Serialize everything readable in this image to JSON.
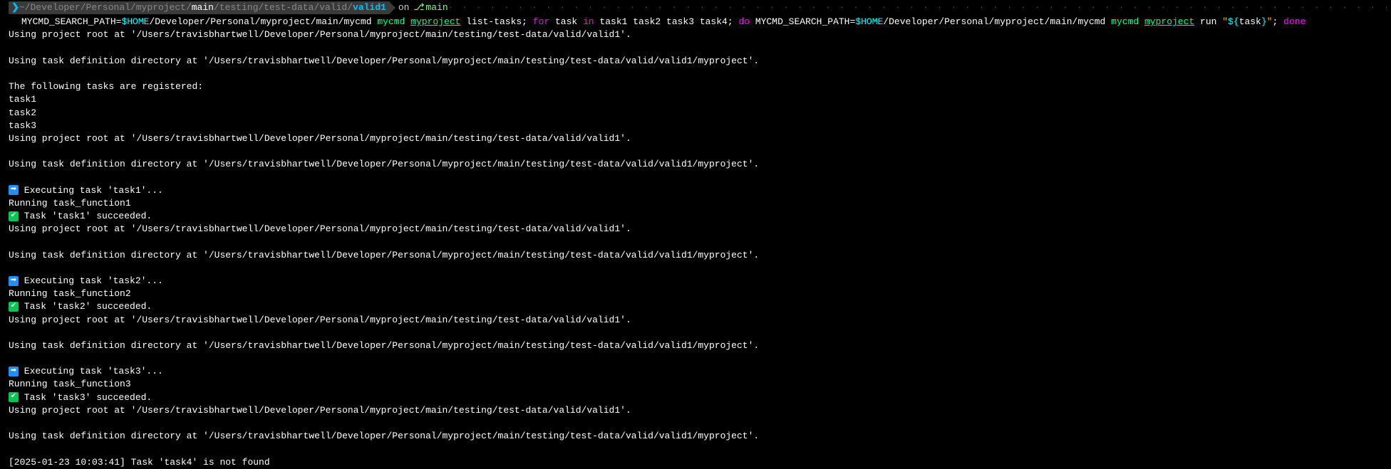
{
  "prompt": {
    "path_prefix": "~/Developer/Personal/myproject/",
    "path_mid1": "main",
    "path_mid2": "/testing/test-data/valid/",
    "path_last": "valid1",
    "on": "on",
    "branch": "main"
  },
  "command": {
    "s1": "MYCMD_SEARCH_PATH=",
    "s2": "$HOME",
    "s3": "/Developer/Personal/myproject/main/mycmd ",
    "s4": "mycmd",
    "s5": " ",
    "s6": "myproject",
    "s7": " list-tasks; ",
    "s8": "for",
    "s9": " task ",
    "s10": "in",
    "s11": " task1 task2 task3 task4; ",
    "s12": "do",
    "s13": " MYCMD_SEARCH_PATH=",
    "s14": "$HOME",
    "s15": "/Developer/Personal/myproject/main/mycmd ",
    "s16": "mycmd",
    "s17": " ",
    "s18": "myproject",
    "s19": " run ",
    "s20": "\"",
    "s21": "${",
    "s22": "task",
    "s23": "}",
    "s24": "\"",
    "s25": "; ",
    "s26": "done"
  },
  "out": {
    "l1": "Using project root at '/Users/travisbhartwell/Developer/Personal/myproject/main/testing/test-data/valid/valid1'.",
    "l2": "Using task definition directory at '/Users/travisbhartwell/Developer/Personal/myproject/main/testing/test-data/valid/valid1/myproject'.",
    "l3": "The following tasks are registered:",
    "l4": "task1",
    "l5": "task2",
    "l6": "task3",
    "l7": "Using project root at '/Users/travisbhartwell/Developer/Personal/myproject/main/testing/test-data/valid/valid1'.",
    "l8": "Using task definition directory at '/Users/travisbhartwell/Developer/Personal/myproject/main/testing/test-data/valid/valid1/myproject'.",
    "l9a": " Executing task 'task1'...",
    "l10": "Running task_function1",
    "l11a": " Task 'task1' succeeded.",
    "l12": "Using project root at '/Users/travisbhartwell/Developer/Personal/myproject/main/testing/test-data/valid/valid1'.",
    "l13": "Using task definition directory at '/Users/travisbhartwell/Developer/Personal/myproject/main/testing/test-data/valid/valid1/myproject'.",
    "l14a": " Executing task 'task2'...",
    "l15": "Running task_function2",
    "l16a": " Task 'task2' succeeded.",
    "l17": "Using project root at '/Users/travisbhartwell/Developer/Personal/myproject/main/testing/test-data/valid/valid1'.",
    "l18": "Using task definition directory at '/Users/travisbhartwell/Developer/Personal/myproject/main/testing/test-data/valid/valid1/myproject'.",
    "l19a": " Executing task 'task3'...",
    "l20": "Running task_function3",
    "l21a": " Task 'task3' succeeded.",
    "l22": "Using project root at '/Users/travisbhartwell/Developer/Personal/myproject/main/testing/test-data/valid/valid1'.",
    "l23": "Using task definition directory at '/Users/travisbhartwell/Developer/Personal/myproject/main/testing/test-data/valid/valid1/myproject'.",
    "l24": "[2025-01-23 10:03:41] Task 'task4' is not found"
  }
}
